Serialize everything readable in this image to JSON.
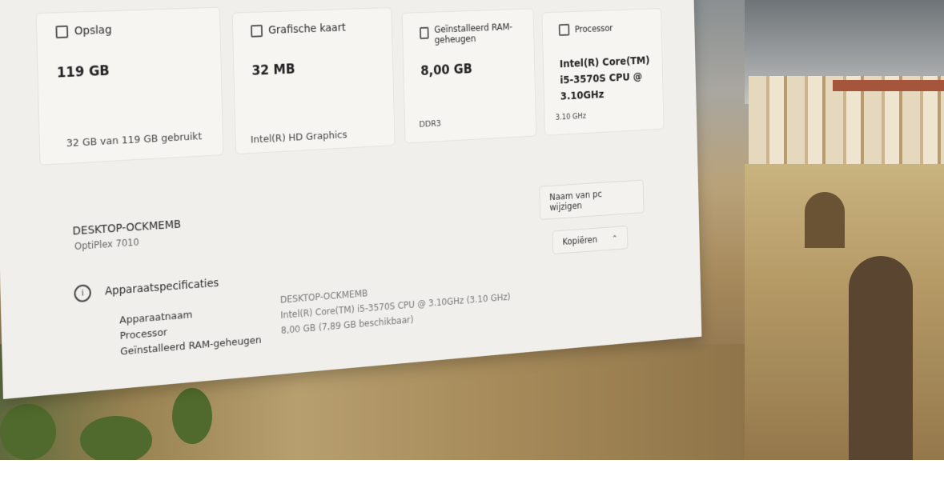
{
  "cards": [
    {
      "title": "Opslag",
      "value": "119 GB",
      "sub": "32 GB van 119 GB gebruikt",
      "icon": "storage-icon"
    },
    {
      "title": "Grafische kaart",
      "value": "32 MB",
      "sub": "Intel(R) HD Graphics",
      "icon": "gpu-icon"
    },
    {
      "title": "Geïnstalleerd RAM-geheugen",
      "value": "8,00 GB",
      "sub": "DDR3",
      "icon": "ram-icon"
    },
    {
      "title": "Processor",
      "value": "Intel(R) Core(TM) i5-3570S CPU @ 3.10GHz",
      "sub": "3.10 GHz",
      "icon": "processor-icon"
    }
  ],
  "pc": {
    "name": "DESKTOP-OCKMEMB",
    "model": "OptiPlex 7010",
    "rename_label": "Naam van pc wijzigen"
  },
  "specs": {
    "header": "Apparaatspecificaties",
    "copy_label": "Kopiëren",
    "rows": [
      {
        "label": "Apparaatnaam",
        "value": "DESKTOP-OCKMEMB"
      },
      {
        "label": "Processor",
        "value": "Intel(R) Core(TM) i5-3570S CPU @ 3.10GHz (3.10 GHz)"
      },
      {
        "label": "Geïnstalleerd RAM-geheugen",
        "value": "8,00 GB (7,89 GB beschikbaar)"
      }
    ]
  },
  "icons": {
    "info": "info-icon",
    "chevron": "chevron-up-icon"
  }
}
